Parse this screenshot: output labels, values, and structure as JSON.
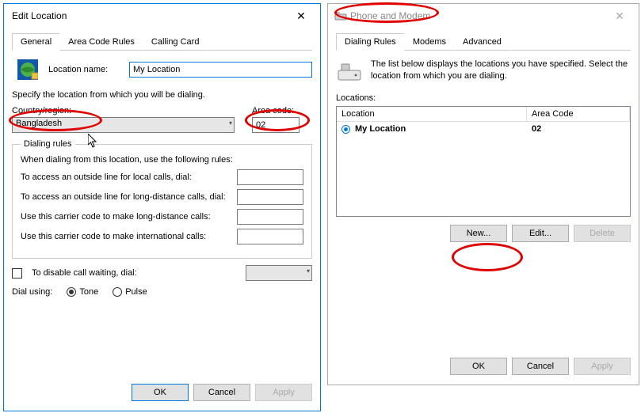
{
  "editDialog": {
    "title": "Edit Location",
    "tabs": [
      {
        "label": "General"
      },
      {
        "label": "Area Code Rules"
      },
      {
        "label": "Calling Card"
      }
    ],
    "locationNameLabel": "Location name:",
    "locationNameValue": "My Location",
    "specifyText": "Specify the location from which you will be dialing.",
    "countryLabel": "Country/region:",
    "countryValue": "Bangladesh",
    "areaCodeLabel": "Area code:",
    "areaCodeValue": "02",
    "dialingRules": {
      "legend": "Dialing rules",
      "intro": "When dialing from this location, use the following rules:",
      "localAccess": "To access an outside line for local calls, dial:",
      "longDistanceAccess": "To access an outside line for long-distance calls, dial:",
      "carrierLongDistance": "Use this carrier code to make long-distance calls:",
      "carrierInternational": "Use this carrier code to make international calls:"
    },
    "disableCallWaiting": "To disable call waiting, dial:",
    "dialUsingLabel": "Dial using:",
    "tone": "Tone",
    "pulse": "Pulse",
    "buttons": {
      "ok": "OK",
      "cancel": "Cancel",
      "apply": "Apply"
    }
  },
  "phoneModemDialog": {
    "title": "Phone and Modem",
    "tabs": [
      {
        "label": "Dialing Rules"
      },
      {
        "label": "Modems"
      },
      {
        "label": "Advanced"
      }
    ],
    "description": "The list below displays the locations you have specified. Select the location from which you are dialing.",
    "locationsLabel": "Locations:",
    "columns": {
      "location": "Location",
      "areaCode": "Area Code"
    },
    "rows": [
      {
        "location": "My Location",
        "areaCode": "02"
      }
    ],
    "buttons": {
      "new": "New...",
      "edit": "Edit...",
      "delete": "Delete",
      "ok": "OK",
      "cancel": "Cancel",
      "apply": "Apply"
    }
  }
}
